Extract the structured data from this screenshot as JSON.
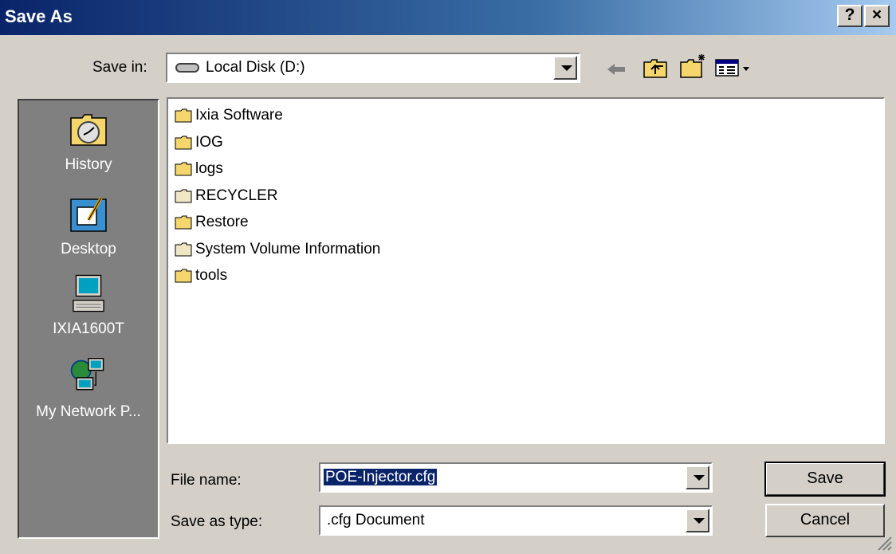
{
  "window": {
    "title": "Save As",
    "help": "?",
    "close": "×"
  },
  "savein": {
    "label": "Save in:",
    "value": "Local Disk (D:)"
  },
  "toolbar": {
    "back": "back-icon",
    "up": "up-folder-icon",
    "newfolder": "new-folder-icon",
    "views": "views-menu-icon"
  },
  "places": [
    {
      "label": "History",
      "icon": "history-icon"
    },
    {
      "label": "Desktop",
      "icon": "desktop-icon"
    },
    {
      "label": "IXIA1600T",
      "icon": "my-computer-icon"
    },
    {
      "label": "My Network P...",
      "icon": "network-places-icon"
    }
  ],
  "files": [
    {
      "name": "Ixia Software",
      "hidden": false
    },
    {
      "name": "IOG",
      "hidden": false
    },
    {
      "name": "logs",
      "hidden": false
    },
    {
      "name": "RECYCLER",
      "hidden": true
    },
    {
      "name": "Restore",
      "hidden": false
    },
    {
      "name": "System Volume Information",
      "hidden": true
    },
    {
      "name": "tools",
      "hidden": false
    }
  ],
  "filename": {
    "label": "File name:",
    "value": "POE-Injector.cfg"
  },
  "filetype": {
    "label": "Save as type:",
    "value": ".cfg Document"
  },
  "buttons": {
    "save": "Save",
    "cancel": "Cancel"
  },
  "colors": {
    "titlebar": "#0a246a",
    "face": "#d4d0c8",
    "folder": "#f4d66c"
  }
}
